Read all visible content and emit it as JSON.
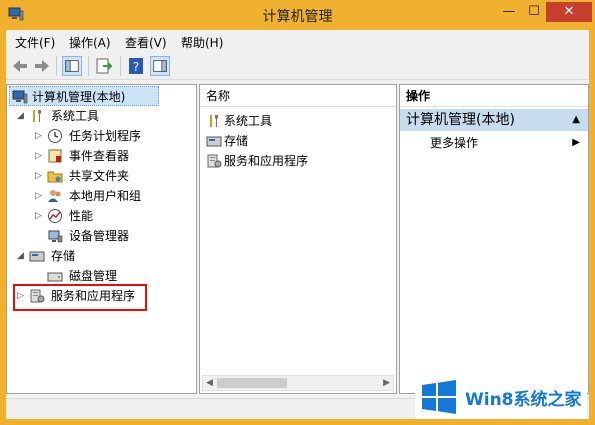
{
  "window": {
    "title": "计算机管理"
  },
  "titlebar": {
    "min": "—",
    "max": "☐",
    "close": "✕"
  },
  "menu": [
    {
      "label": "文件(F)"
    },
    {
      "label": "操作(A)"
    },
    {
      "label": "查看(V)"
    },
    {
      "label": "帮助(H)"
    }
  ],
  "tree": {
    "root": "计算机管理(本地)",
    "system_tools": "系统工具",
    "items": {
      "task_scheduler": "任务计划程序",
      "event_viewer": "事件查看器",
      "shared_folders": "共享文件夹",
      "local_users": "本地用户和组",
      "performance": "性能",
      "device_manager": "设备管理器"
    },
    "storage": "存储",
    "disk_management": "磁盘管理",
    "services_apps": "服务和应用程序"
  },
  "center": {
    "column": "名称",
    "items": [
      "系统工具",
      "存储",
      "服务和应用程序"
    ]
  },
  "actions": {
    "header": "操作",
    "section": "计算机管理(本地)",
    "more": "更多操作"
  },
  "watermark": {
    "text": "Win8系统之家"
  },
  "colors": {
    "titlebar": "#f0b030",
    "close": "#c7402e",
    "highlight": "#c8dcf0",
    "redbox": "#e01010",
    "accent": "#1478d4"
  }
}
